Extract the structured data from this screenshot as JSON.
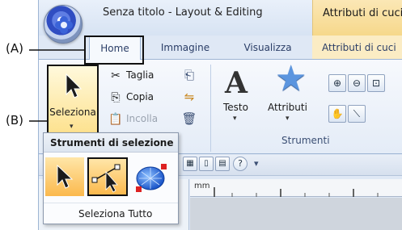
{
  "window": {
    "title": "Senza titolo - Layout & Editing",
    "contextual_tab_title": "Attributi di cuci"
  },
  "tabs": [
    {
      "label": "Home"
    },
    {
      "label": "Immagine"
    },
    {
      "label": "Visualizza"
    },
    {
      "label": "Attributi di cuci"
    }
  ],
  "ribbon": {
    "seleziona_label": "Seleziona",
    "clipboard": {
      "cut": "Taglia",
      "copy": "Copia",
      "paste": "Incolla"
    },
    "tools": {
      "text": "Testo",
      "attributes": "Attributi"
    },
    "group_tools_label": "Strumenti"
  },
  "dropdown": {
    "header": "Strumenti di selezione",
    "items": [
      {
        "icon": "select-arrow-icon",
        "selected": true
      },
      {
        "icon": "point-edit-icon",
        "selected": true,
        "highlighted": true
      },
      {
        "icon": "circle-select-icon",
        "selected": false
      }
    ],
    "select_all": "Seleziona Tutto"
  },
  "ruler": {
    "unit": "mm"
  },
  "callouts": {
    "a": "(A)",
    "b": "(B)"
  },
  "colors": {
    "ribbon_bg": "#e4ecf7",
    "highlight_orange": "#fbb94d",
    "contextual_tab": "#f6d88b",
    "star_blue": "#5b95df"
  }
}
